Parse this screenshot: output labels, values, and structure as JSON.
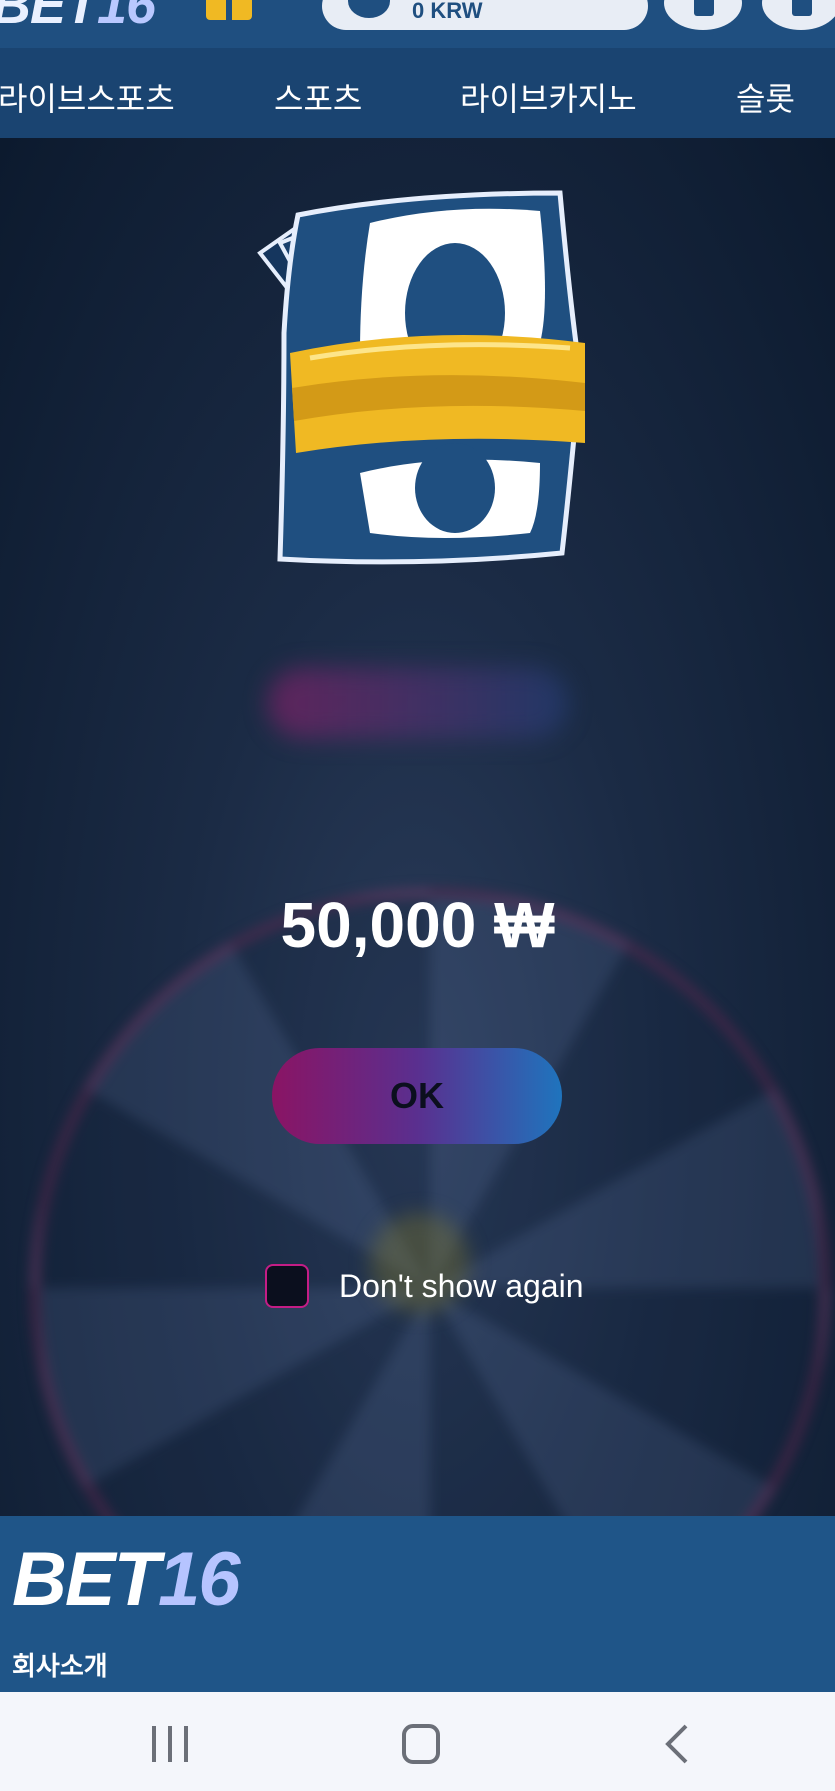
{
  "header": {
    "logo_text": "BET",
    "logo_num": "16",
    "balance": "0 KRW"
  },
  "nav": {
    "items": [
      "라이브스포츠",
      "스포츠",
      "라이브카지노",
      "슬롯"
    ]
  },
  "modal": {
    "amount": "50,000 ₩",
    "ok_label": "OK",
    "dont_show_label": "Don't show again",
    "dont_show_checked": false
  },
  "footer": {
    "logo_text": "BET",
    "logo_num": "16",
    "link_about": "회사소개"
  },
  "system_nav": {
    "icons": [
      "recents-icon",
      "home-icon",
      "back-icon"
    ]
  },
  "colors": {
    "brand_blue": "#1f4f80",
    "accent_magenta": "#8a1464",
    "accent_blue": "#1f74bd",
    "gold": "#f0b923"
  }
}
